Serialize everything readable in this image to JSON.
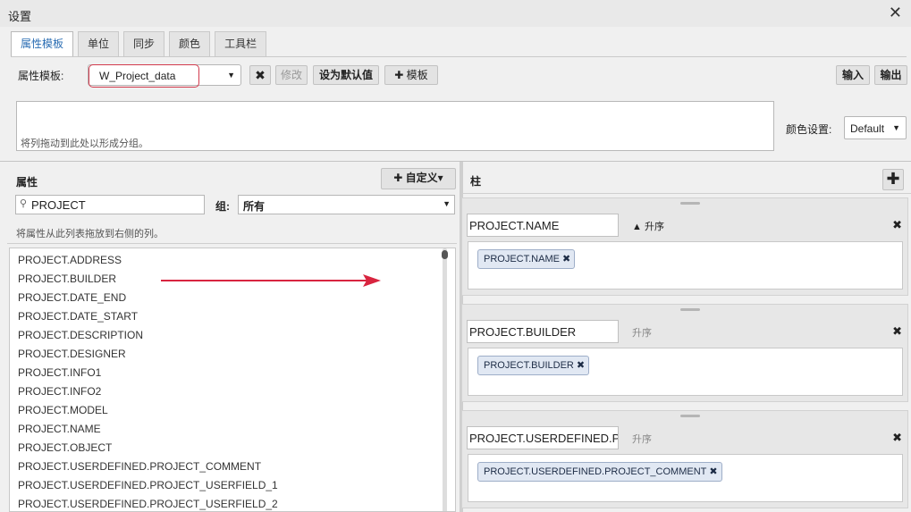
{
  "window": {
    "title": "设置",
    "close_glyph": "✕"
  },
  "tabs": [
    {
      "label": "属性模板",
      "active": true
    },
    {
      "label": "单位",
      "active": false
    },
    {
      "label": "同步",
      "active": false
    },
    {
      "label": "颜色",
      "active": false
    },
    {
      "label": "工具栏",
      "active": false
    }
  ],
  "template_bar": {
    "label": "属性模板:",
    "selected": "W_Project_data",
    "delete_glyph": "✖",
    "modify_label": "修改",
    "set_default_label": "设为默认值",
    "add_template_label": "✚ 模板",
    "import_label": "输入",
    "export_label": "输出"
  },
  "grouping": {
    "hint": "将列拖动到此处以形成分组。",
    "color_label": "颜色设置:",
    "color_value": "Default"
  },
  "attributes": {
    "title": "属性",
    "custom_button": "✚ 自定义▾",
    "search_value": "PROJECT",
    "group_label": "组:",
    "group_value": "所有",
    "drag_hint": "将属性从此列表拖放到右侧的列。",
    "items": [
      "PROJECT.ADDRESS",
      "PROJECT.BUILDER",
      "PROJECT.DATE_END",
      "PROJECT.DATE_START",
      "PROJECT.DESCRIPTION",
      "PROJECT.DESIGNER",
      "PROJECT.INFO1",
      "PROJECT.INFO2",
      "PROJECT.MODEL",
      "PROJECT.NAME",
      "PROJECT.OBJECT",
      "PROJECT.USERDEFINED.PROJECT_COMMENT",
      "PROJECT.USERDEFINED.PROJECT_USERFIELD_1",
      "PROJECT.USERDEFINED.PROJECT_USERFIELD_2"
    ]
  },
  "columns": {
    "title": "柱",
    "add_glyph": "✚",
    "items": [
      {
        "name": "PROJECT.NAME",
        "sort": "▲ 升序",
        "sort_active": true,
        "chip": "PROJECT.NAME"
      },
      {
        "name": "PROJECT.BUILDER",
        "sort": "升序",
        "sort_active": false,
        "chip": "PROJECT.BUILDER"
      },
      {
        "name": "PROJECT.USERDEFINED.PROJECT_COMMENT",
        "sort": "升序",
        "sort_active": false,
        "chip": "PROJECT.USERDEFINED.PROJECT_COMMENT"
      }
    ]
  },
  "colors": {
    "accent_tab": "#2a6db3",
    "highlight": "#d23a4d",
    "arrow": "#d8243f"
  }
}
